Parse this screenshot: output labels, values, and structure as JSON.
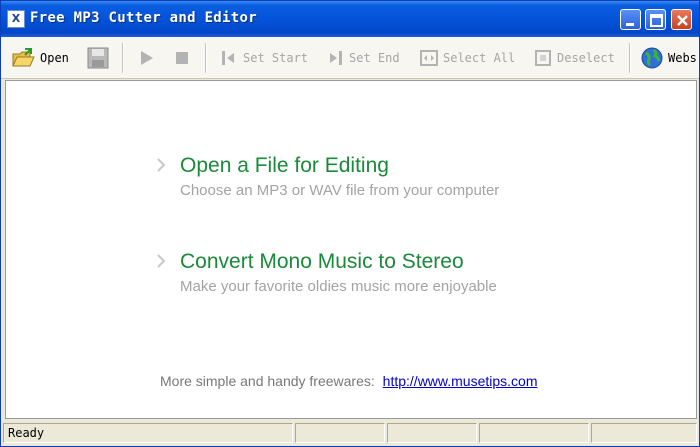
{
  "window": {
    "title": "Free MP3 Cutter and Editor",
    "icon_text": "X"
  },
  "toolbar": {
    "open": "Open",
    "set_start": "Set Start",
    "set_end": "Set End",
    "select_all": "Select All",
    "deselect": "Deselect",
    "website": "Webs"
  },
  "actions": [
    {
      "title": "Open a File for Editing",
      "subtitle": "Choose an MP3 or WAV file from your computer"
    },
    {
      "title": "Convert Mono Music to Stereo",
      "subtitle": "Make your favorite oldies music more enjoyable"
    }
  ],
  "footer": {
    "text": "More simple and handy freewares:",
    "link": "http://www.musetips.com"
  },
  "status": {
    "text": "Ready"
  },
  "colors": {
    "accent_green": "#1a8a3a",
    "link_blue": "#0000cc",
    "title_blue": "#0453d8"
  }
}
